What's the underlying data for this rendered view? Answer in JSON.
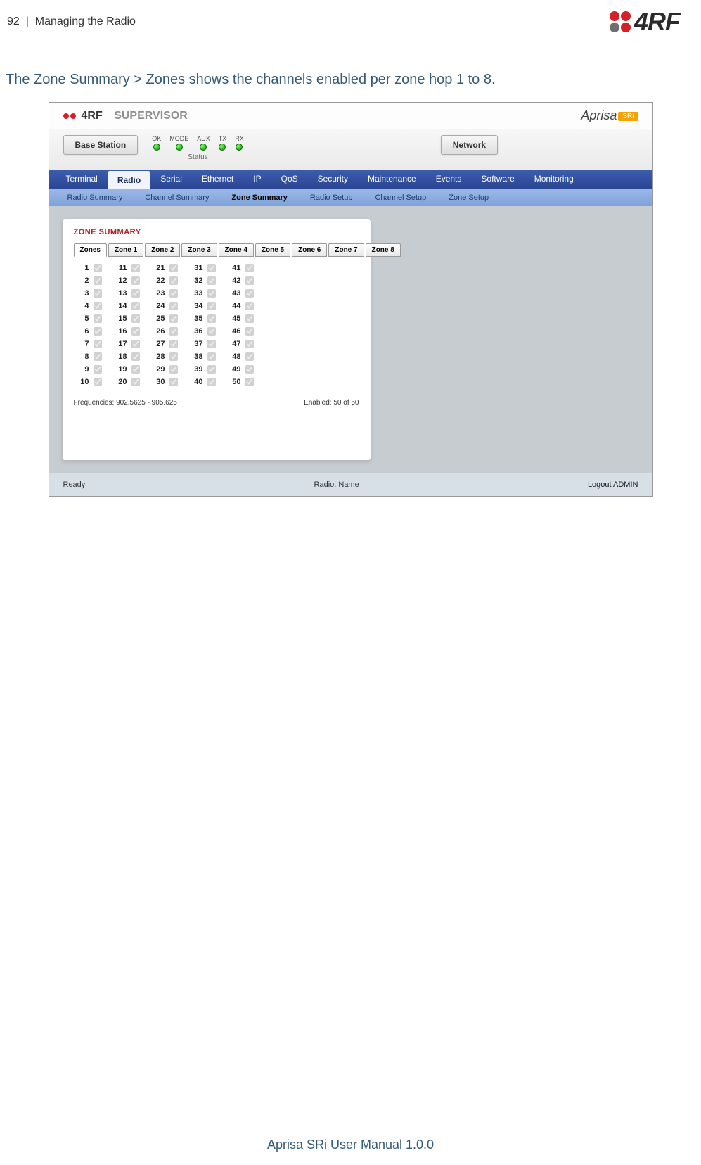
{
  "pageNumber": "92",
  "sectionTitle": "Managing the Radio",
  "bodyParagraph": "The Zone Summary > Zones shows the channels enabled per zone hop 1 to 8.",
  "supervisorLabel": "SUPERVISOR",
  "aprisaText": "Aprisa",
  "aprisaBadge": "SRi",
  "baseStationBtn": "Base Station",
  "networkBtn": "Network",
  "leds": [
    "OK",
    "MODE",
    "AUX",
    "TX",
    "RX"
  ],
  "ledStatusLabel": "Status",
  "mainNav": [
    "Terminal",
    "Radio",
    "Serial",
    "Ethernet",
    "IP",
    "QoS",
    "Security",
    "Maintenance",
    "Events",
    "Software",
    "Monitoring"
  ],
  "mainNavActive": 1,
  "subNav": [
    "Radio Summary",
    "Channel Summary",
    "Zone Summary",
    "Radio Setup",
    "Channel Setup",
    "Zone Setup"
  ],
  "subNavActive": 2,
  "panelTitle": "ZONE SUMMARY",
  "zoneTabs": [
    "Zones",
    "Zone 1",
    "Zone 2",
    "Zone 3",
    "Zone 4",
    "Zone 5",
    "Zone 6",
    "Zone 7",
    "Zone 8"
  ],
  "zoneTabActive": 0,
  "channels": [
    [
      "1",
      "2",
      "3",
      "4",
      "5",
      "6",
      "7",
      "8",
      "9",
      "10"
    ],
    [
      "11",
      "12",
      "13",
      "14",
      "15",
      "16",
      "17",
      "18",
      "19",
      "20"
    ],
    [
      "21",
      "22",
      "23",
      "24",
      "25",
      "26",
      "27",
      "28",
      "29",
      "30"
    ],
    [
      "31",
      "32",
      "33",
      "34",
      "35",
      "36",
      "37",
      "38",
      "39",
      "40"
    ],
    [
      "41",
      "42",
      "43",
      "44",
      "45",
      "46",
      "47",
      "48",
      "49",
      "50"
    ]
  ],
  "freqText": "Frequencies: 902.5625 - 905.625",
  "enabledText": "Enabled: 50 of 50",
  "statusLeft": "Ready",
  "statusCenter": "Radio: Name",
  "statusRight": "Logout ADMIN",
  "footer": "Aprisa SRi User Manual 1.0.0"
}
